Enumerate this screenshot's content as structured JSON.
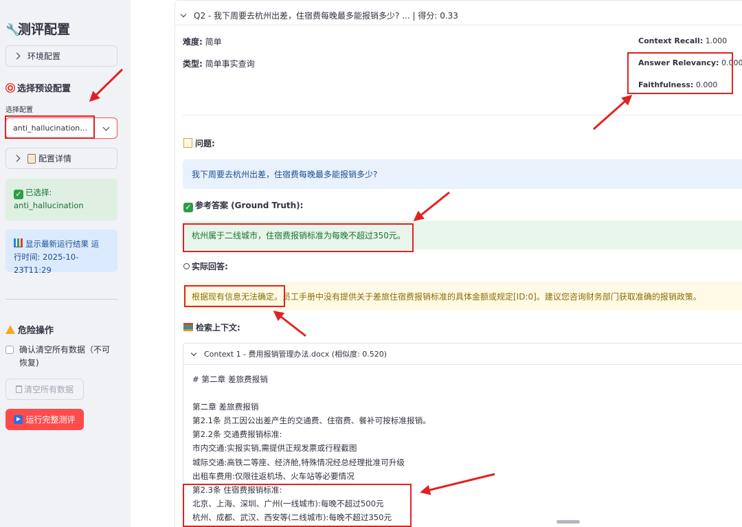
{
  "sidebar": {
    "title": "测评配置",
    "env_config_label": "环境配置",
    "preset_section_title": "选择预设配置",
    "select_label": "选择配置",
    "select_value": "anti_hallucination - ...",
    "config_detail_label": "配置详情",
    "selected_text": "已选择:",
    "selected_value": "anti_hallucination",
    "info_line1": "显示最新运行结果 运",
    "info_line2": "行时间: 2025-10-23T11:29",
    "danger_title": "危险操作",
    "confirm_line1": "确认清空所有数据（不可",
    "confirm_line2": "恢复)",
    "clear_button": "清空所有数据",
    "run_button": "运行完整测评"
  },
  "main": {
    "expander_title": "Q2 - 我下周要去杭州出差，住宿费每晚最多能报销多少? ... | 得分: 0.33",
    "difficulty_label": "难度:",
    "difficulty_value": "简单",
    "type_label": "类型:",
    "type_value": "简单事实查询",
    "metrics": [
      {
        "label": "Context Recall:",
        "value": "1.000"
      },
      {
        "label": "Answer Relevancy:",
        "value": "0.000"
      },
      {
        "label": "Faithfulness:",
        "value": "0.000"
      }
    ],
    "question_title": "问题:",
    "question_text": "我下周要去杭州出差，住宿费每晚最多能报销多少?",
    "reference_title": "参考答案 (Ground Truth):",
    "reference_text": "杭州属于二线城市，住宿费报销标准为每晚不超过350元。",
    "actual_title": "实际回答:",
    "actual_text": "根据现有信息无法确定。员工手册中没有提供关于差旅住宿费报销标准的具体金额或规定[ID:0]。建议您咨询财务部门获取准确的报销政策。",
    "retrieved_title": "检索上下文:",
    "context_header": "Context 1 - 费用报销管理办法.docx (相似度: 0.520)",
    "context_lines": [
      "# 第二章 差旅费报销",
      "",
      "第二章 差旅费报销",
      "第2.1条 员工因公出差产生的交通费、住宿费、餐补可按标准报销。",
      "第2.2条 交通费报销标准:",
      "市内交通:实报实销,需提供正规发票或行程截图",
      "城际交通:高铁二等座、经济舱,特殊情况经总经理批准可升级",
      "出租车费用:仅限往返机场、火车站等必要情况",
      "第2.3条 住宿费报销标准:",
      "北京、上海、深圳、广州(一线城市):每晚不超过500元",
      "杭州、成都、武汉、西安等(二线城市):每晚不超过350元"
    ]
  },
  "colors": {
    "primary": "#ff4b4b",
    "annotation": "#e32020",
    "success": "#177233",
    "info": "#1d4f91",
    "warning": "#8a6d04"
  },
  "icons": [
    "wrench-icon",
    "target-icon",
    "chevron-right-icon",
    "chevron-down-icon",
    "clipboard-icon",
    "check-icon",
    "chart-icon",
    "warning-icon",
    "trash-icon",
    "play-icon",
    "memo-icon",
    "robot-icon",
    "books-icon"
  ]
}
